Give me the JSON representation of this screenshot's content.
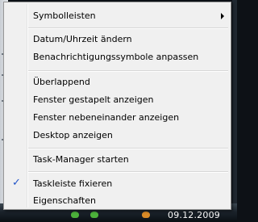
{
  "taskbar": {
    "clock": "09.12.2009"
  },
  "context_menu": {
    "items": [
      {
        "label": "Symbolleisten",
        "submenu": true
      },
      {
        "label": "Datum/Uhrzeit ändern"
      },
      {
        "label": "Benachrichtigungssymbole anpassen"
      },
      {
        "label": "Überlappend"
      },
      {
        "label": "Fenster gestapelt anzeigen"
      },
      {
        "label": "Fenster nebeneinander anzeigen"
      },
      {
        "label": "Desktop anzeigen"
      },
      {
        "label": "Task-Manager starten"
      },
      {
        "label": "Taskleiste fixieren",
        "checked": true
      },
      {
        "label": "Eigenschaften"
      }
    ],
    "check_glyph": "✓",
    "accent_color": "#2255c8"
  }
}
